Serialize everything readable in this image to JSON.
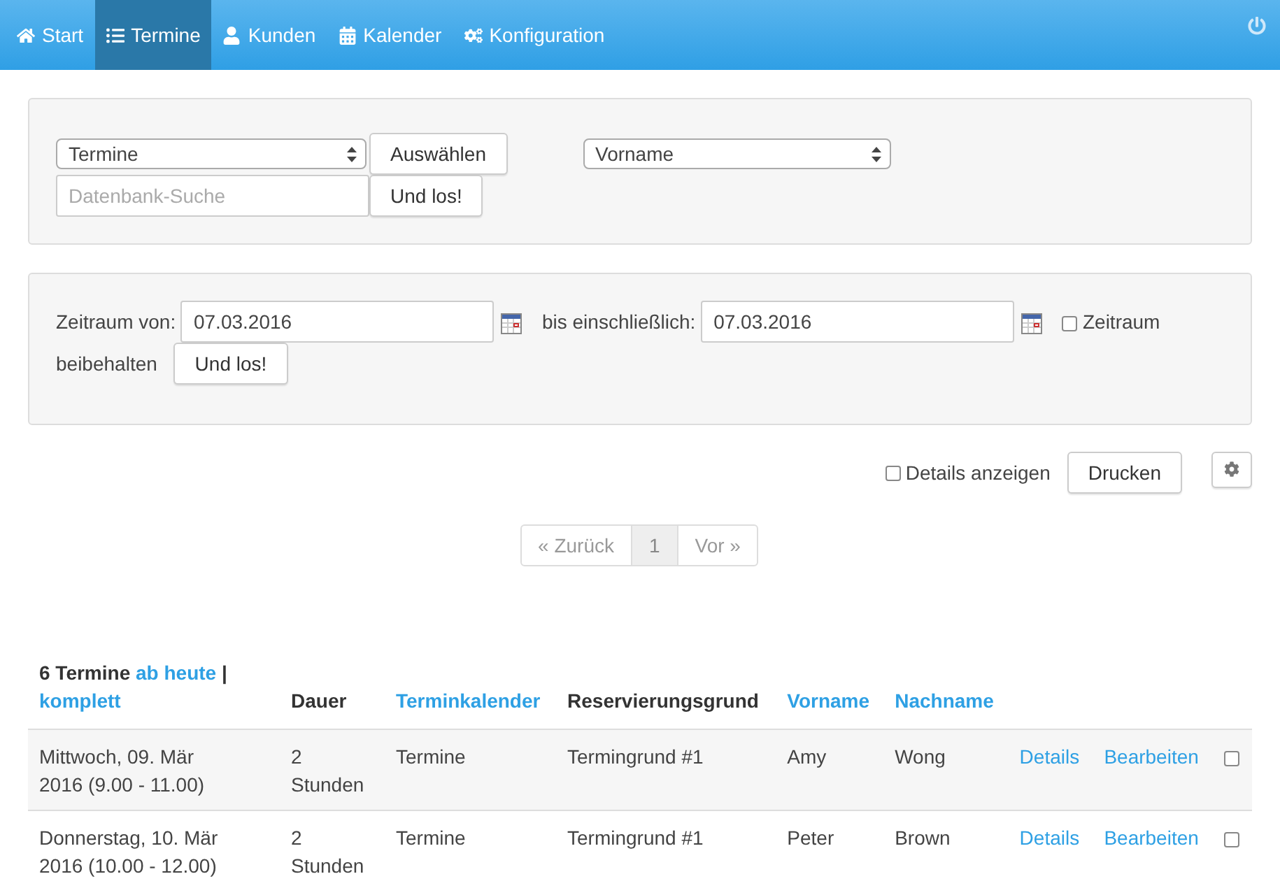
{
  "nav": {
    "items": [
      {
        "label": "Start",
        "selected": false
      },
      {
        "label": "Termine",
        "selected": true
      },
      {
        "label": "Kunden",
        "selected": false
      },
      {
        "label": "Kalender",
        "selected": false
      },
      {
        "label": "Konfiguration",
        "selected": false
      }
    ]
  },
  "search_panel": {
    "type_select": "Termine",
    "select_button": "Auswählen",
    "search_placeholder": "Datenbank-Suche",
    "search_button": "Und los!",
    "field_select": "Vorname"
  },
  "date_panel": {
    "from_label": "Zeitraum von:",
    "from_value": "07.03.2016",
    "to_label": "bis einschließlich:",
    "to_value": "07.03.2016",
    "keep_label_lines": [
      "Zeitraum",
      "beibehalten"
    ],
    "keep_checked": false,
    "button": "Und los!"
  },
  "toolbar": {
    "details_label": "Details anzeigen",
    "details_checked": false,
    "print_button": "Drucken"
  },
  "pagination": {
    "prev": "« Zurück",
    "pages": [
      {
        "label": "1",
        "selected": true
      }
    ],
    "next": "Vor »"
  },
  "table": {
    "count": "6 Termine",
    "filter_links": [
      "ab heute",
      "komplett"
    ],
    "filter_separator": "|",
    "columns": [
      {
        "label": "Dauer",
        "kind": "plain"
      },
      {
        "label": "Terminkalender",
        "kind": "link"
      },
      {
        "label": "Reservierungsgrund",
        "kind": "plain"
      },
      {
        "label": "Vorname",
        "kind": "link"
      },
      {
        "label": "Nachname",
        "kind": "link"
      }
    ],
    "rows": [
      {
        "date": "Mittwoch, 09. Mär 2016 (9.00 - 11.00)",
        "duration": "2 Stunden",
        "calendar": "Termine",
        "reason": "Termingrund #1",
        "first_name": "Amy",
        "last_name": "Wong",
        "details": "Details",
        "edit": "Bearbeiten",
        "checked": false
      },
      {
        "date": "Donnerstag, 10. Mär 2016 (10.00 - 12.00)",
        "duration": "2 Stunden",
        "calendar": "Termine",
        "reason": "Termingrund #1",
        "first_name": "Peter",
        "last_name": "Brown",
        "details": "Details",
        "edit": "Bearbeiten",
        "checked": false
      }
    ]
  }
}
